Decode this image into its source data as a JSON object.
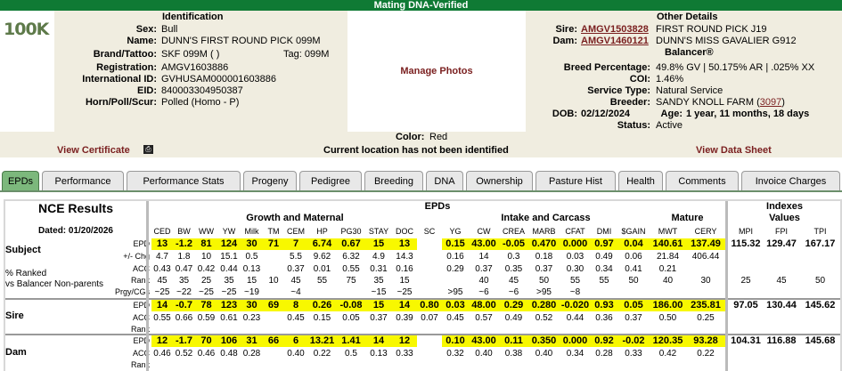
{
  "header": {
    "title": "Mating DNA-Verified"
  },
  "logo": {
    "text": "100K"
  },
  "identification": {
    "heading": "Identification",
    "rows": [
      {
        "label": "Sex:",
        "value": "Bull"
      },
      {
        "label": "Name:",
        "value": "DUNN'S FIRST ROUND PICK 099M"
      },
      {
        "label": "Brand/Tattoo:",
        "value": "SKF 099M ( )",
        "extra": "Tag: 099M"
      },
      {
        "label": "Registration:",
        "value": "AMGV1603886"
      },
      {
        "label": "International ID:",
        "value": "GVHUSAM000001603886"
      },
      {
        "label": "EID:",
        "value": "840003304950387"
      },
      {
        "label": "Horn/Poll/Scur:",
        "value": "Polled (Homo - P)"
      }
    ]
  },
  "photos": {
    "label": "Manage Photos"
  },
  "other": {
    "heading": "Other Details",
    "sire_label": "Sire:",
    "sire_reg": "AMGV1503828",
    "sire_name": "FIRST ROUND PICK J19",
    "dam_label": "Dam:",
    "dam_reg": "AMGV1460121",
    "dam_name": "DUNN'S MISS GAVALIER G912",
    "breed_type": "Balancer®",
    "rows": [
      {
        "label": "Breed Percentage:",
        "value": "49.8% GV | 50.175% AR | .025% XX"
      },
      {
        "label": "COI:",
        "value": "1.46%"
      },
      {
        "label": "Service Type:",
        "value": "Natural Service"
      }
    ],
    "breeder_label": "Breeder:",
    "breeder_value": "SANDY KNOLL FARM (",
    "breeder_id": "3097",
    "breeder_close": ")",
    "dob_label": "DOB:",
    "dob_value": "02/12/2024",
    "age_label": "Age:",
    "age_value": "1 year, 11 months, 18 days",
    "status_label": "Status:",
    "status_value": "Active"
  },
  "color": {
    "label": "Color:",
    "value": "Red"
  },
  "cert": {
    "view_certificate": "View Certificate",
    "location": "Current location has not been identified",
    "view_data_sheet": "View Data Sheet"
  },
  "tabs": [
    "EPDs",
    "Performance",
    "Performance Stats",
    "Progeny",
    "Pedigree",
    "Breeding",
    "DNA",
    "Ownership",
    "Pasture Hist",
    "Health",
    "Comments",
    "Invoice Charges"
  ],
  "epd": {
    "nce": "NCE Results",
    "dated": "Dated: 01/20/2026",
    "epds_title": "EPDs",
    "indexes_title": "Indexes",
    "growth": "Growth and Maternal",
    "intake": "Intake and Carcass",
    "mature": "Mature",
    "values": "Values",
    "cols": [
      "CED",
      "BW",
      "WW",
      "YW",
      "Milk",
      "TM",
      "CEM",
      "HP",
      "PG30",
      "STAY",
      "DOC",
      "SC",
      "YG",
      "CW",
      "CREA",
      "MARB",
      "CFAT",
      "DMI",
      "$GAIN",
      "MWT",
      "CERY",
      "MPI",
      "FPI",
      "TPI"
    ],
    "subject_label": "Subject",
    "pct_label": "% Ranked\nvs Balancer Non-parents",
    "sire_label": "Sire",
    "dam_label": "Dam",
    "row_labels": {
      "epd": "EPD",
      "chg": "+/- Chg",
      "acc": "ACC",
      "rank": "Rank",
      "prgy": "Prgy/CGs"
    },
    "subject": {
      "epd": [
        "13",
        "-1.2",
        "81",
        "124",
        "30",
        "71",
        "7",
        "6.74",
        "0.67",
        "15",
        "13",
        "",
        "0.15",
        "43.00",
        "-0.05",
        "0.470",
        "0.000",
        "0.97",
        "0.04",
        "140.61",
        "137.49",
        "115.32",
        "129.47",
        "167.17"
      ],
      "chg": [
        "4.7",
        "1.8",
        "10",
        "15.1",
        "0.5",
        "",
        "5.5",
        "9.62",
        "6.32",
        "4.9",
        "14.3",
        "",
        "0.16",
        "14",
        "0.3",
        "0.18",
        "0.03",
        "0.49",
        "0.06",
        "21.84",
        "406.44",
        "",
        "",
        ""
      ],
      "acc": [
        "0.43",
        "0.47",
        "0.42",
        "0.44",
        "0.13",
        "",
        "0.37",
        "0.01",
        "0.55",
        "0.31",
        "0.16",
        "",
        "0.29",
        "0.37",
        "0.35",
        "0.37",
        "0.30",
        "0.34",
        "0.41",
        "0.21",
        "",
        "",
        "",
        ""
      ],
      "rank": [
        "45",
        "35",
        "25",
        "35",
        "15",
        "10",
        "45",
        "55",
        "75",
        "35",
        "15",
        "",
        "",
        "40",
        "45",
        "50",
        "55",
        "55",
        "50",
        "40",
        "30",
        "25",
        "45",
        "50"
      ],
      "prgy": [
        "~25",
        "~22",
        "~25",
        "~25",
        "~19",
        "",
        "~4",
        "",
        "",
        "~15",
        "~25",
        "",
        ">95",
        "~6",
        "~6",
        ">95",
        "~8",
        "",
        "",
        "",
        "",
        "",
        "",
        ""
      ]
    },
    "sire": {
      "epd": [
        "14",
        "-0.7",
        "78",
        "123",
        "30",
        "69",
        "8",
        "0.26",
        "-0.08",
        "15",
        "14",
        "0.80",
        "0.03",
        "48.00",
        "0.29",
        "0.280",
        "-0.020",
        "0.93",
        "0.05",
        "186.00",
        "235.81",
        "97.05",
        "130.44",
        "145.62"
      ],
      "acc": [
        "0.55",
        "0.66",
        "0.59",
        "0.61",
        "0.23",
        "",
        "0.45",
        "0.15",
        "0.05",
        "0.37",
        "0.39",
        "0.07",
        "0.45",
        "0.57",
        "0.49",
        "0.52",
        "0.44",
        "0.36",
        "0.37",
        "0.50",
        "0.25",
        "",
        "",
        ""
      ],
      "rank": [
        "",
        "",
        "",
        "",
        "",
        "",
        "",
        "",
        "",
        "",
        "",
        "",
        "",
        "",
        "",
        "",
        "",
        "",
        "",
        "",
        "",
        "",
        "",
        ""
      ]
    },
    "dam": {
      "epd": [
        "12",
        "-1.7",
        "70",
        "106",
        "31",
        "66",
        "6",
        "13.21",
        "1.41",
        "14",
        "12",
        "",
        "0.10",
        "43.00",
        "0.11",
        "0.350",
        "0.000",
        "0.92",
        "-0.02",
        "120.35",
        "93.28",
        "104.31",
        "116.88",
        "145.68"
      ],
      "acc": [
        "0.46",
        "0.52",
        "0.46",
        "0.48",
        "0.28",
        "",
        "0.40",
        "0.22",
        "0.5",
        "0.13",
        "0.33",
        "",
        "0.32",
        "0.40",
        "0.38",
        "0.40",
        "0.34",
        "0.28",
        "0.33",
        "0.42",
        "0.22",
        "",
        "",
        ""
      ],
      "rank": [
        "",
        "",
        "",
        "",
        "",
        "",
        "",
        "",
        "",
        "",
        "",
        "",
        "",
        "",
        "",
        "",
        "",
        "",
        "",
        "",
        "",
        "",
        "",
        ""
      ]
    }
  },
  "colors": {
    "accent_green": "#0f7a34",
    "panel": "#f0ede0",
    "highlight": "#f8f800",
    "link": "#7a1f1f"
  }
}
